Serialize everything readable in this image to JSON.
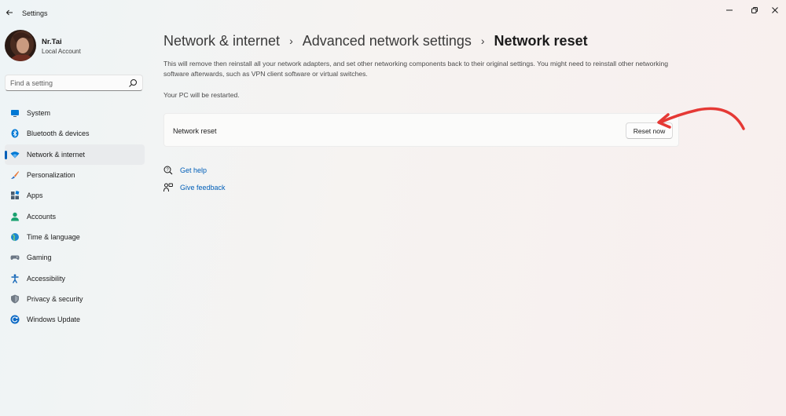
{
  "window": {
    "title": "Settings"
  },
  "user": {
    "name": "Nr.Tai",
    "account_type": "Local Account"
  },
  "search": {
    "placeholder": "Find a setting"
  },
  "sidebar": {
    "active": "Network & internet",
    "items": [
      {
        "label": "System",
        "icon": "system-icon",
        "color": "#0078d4"
      },
      {
        "label": "Bluetooth & devices",
        "icon": "bluetooth-icon",
        "color": "#0078d4"
      },
      {
        "label": "Network & internet",
        "icon": "wifi-icon",
        "color": "#0078d4"
      },
      {
        "label": "Personalization",
        "icon": "brush-icon",
        "color": "#e8793a"
      },
      {
        "label": "Apps",
        "icon": "apps-icon",
        "color": "#4a5b6e"
      },
      {
        "label": "Accounts",
        "icon": "person-icon",
        "color": "#1aa16f"
      },
      {
        "label": "Time & language",
        "icon": "globe-icon",
        "color": "#1e88d0"
      },
      {
        "label": "Gaming",
        "icon": "gamepad-icon",
        "color": "#6b7785"
      },
      {
        "label": "Accessibility",
        "icon": "accessibility-icon",
        "color": "#1467b8"
      },
      {
        "label": "Privacy & security",
        "icon": "shield-icon",
        "color": "#707a85"
      },
      {
        "label": "Windows Update",
        "icon": "update-icon",
        "color": "#0a68c4"
      }
    ]
  },
  "breadcrumb": {
    "items": [
      "Network & internet",
      "Advanced network settings"
    ],
    "separator": "›",
    "current": "Network reset"
  },
  "main": {
    "description": "This will remove then reinstall all your network adapters, and set other networking components back to their original settings. You might need to reinstall other networking software afterwards, such as VPN client software or virtual switches.",
    "restart_note": "Your PC will be restarted.",
    "card_label": "Network reset",
    "reset_button": "Reset now"
  },
  "links": {
    "get_help": "Get help",
    "give_feedback": "Give feedback"
  },
  "colors": {
    "accent": "#005fb8",
    "annotation_arrow": "#e53935"
  }
}
